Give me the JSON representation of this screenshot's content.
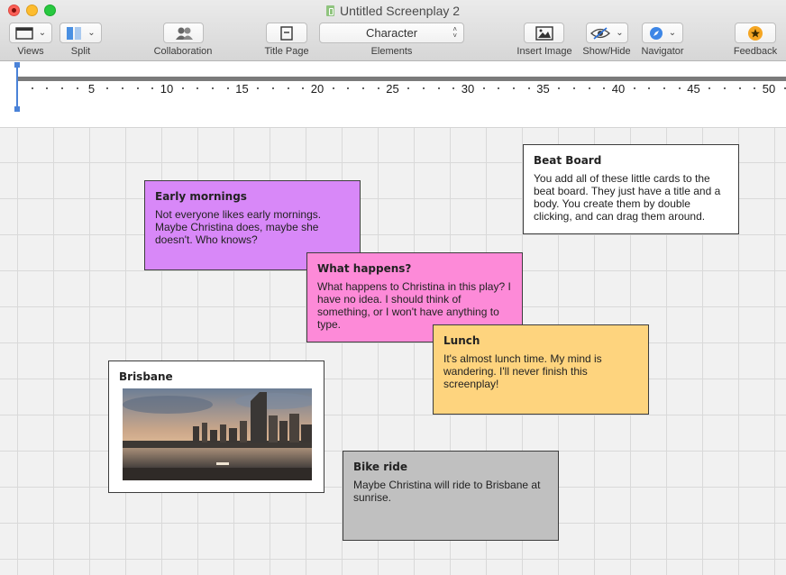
{
  "window": {
    "title": "Untitled Screenplay 2"
  },
  "toolbar": {
    "views_label": "Views",
    "split_label": "Split",
    "collaboration_label": "Collaboration",
    "title_page_label": "Title Page",
    "elements_label": "Elements",
    "elements_value": "Character",
    "insert_image_label": "Insert Image",
    "show_hide_label": "Show/Hide",
    "navigator_label": "Navigator",
    "feedback_label": "Feedback"
  },
  "ruler": {
    "numbers": [
      "5",
      "10",
      "15",
      "20",
      "25",
      "30",
      "35",
      "40",
      "45",
      "50"
    ]
  },
  "cards": [
    {
      "title": "Beat Board",
      "body": "You add all of these little cards to the beat board. They just have a title and a body. You create them by double clicking, and can drag them around.",
      "color": "#ffffff"
    },
    {
      "title": "Early mornings",
      "body": "Not everyone likes early mornings. Maybe Christina does, maybe she doesn't. Who knows?",
      "color": "#d888f8"
    },
    {
      "title": "What happens?",
      "body": "What happens to Christina in this play? I have no idea. I should think of something, or I won't have anything to type.",
      "color": "#fd8ad8"
    },
    {
      "title": "Lunch",
      "body": "It's almost lunch time. My mind is wandering. I'll never finish this screenplay!",
      "color": "#fed47e"
    },
    {
      "title": "Brisbane",
      "color": "#ffffff"
    },
    {
      "title": "Bike ride",
      "body": "Maybe Christina will ride to Brisbane at sunrise.",
      "color": "#c0c0c0"
    }
  ],
  "colors": {
    "accent": "#4a82d8",
    "feedback_star": "#f5a623"
  }
}
